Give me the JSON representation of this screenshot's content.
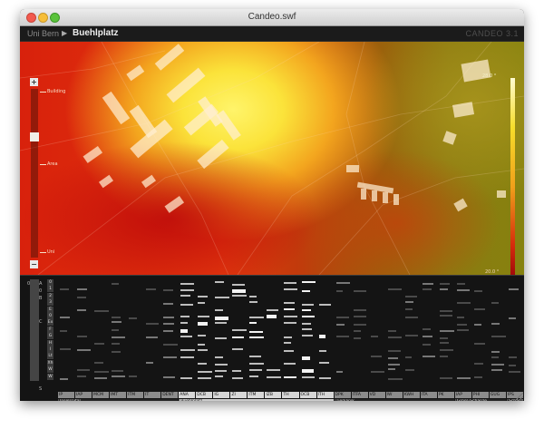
{
  "window": {
    "title": "Candeo.swf"
  },
  "header": {
    "breadcrumb_root": "Uni Bern",
    "breadcrumb_current": "Buehlplatz",
    "brand": "CANDEO 3.1"
  },
  "map": {
    "zoom_labels": [
      "Building",
      "Area",
      "Uni"
    ],
    "zoom_plus": "+",
    "zoom_minus": "−",
    "legend_max": "28.0 °",
    "legend_min": "20.0 °"
  },
  "panel": {
    "side_top_labels": [
      "0",
      "A",
      "0",
      "B",
      "C"
    ],
    "side_bottom_label": "S",
    "row_labels": [
      "0",
      "1",
      "2",
      "3",
      "E",
      "0",
      "Ex",
      "F",
      "G",
      "H",
      "I",
      "Lt",
      "Xh",
      "W",
      "W"
    ],
    "columns": [
      "IP",
      "IAP",
      "MCM",
      "IMT",
      "ITM",
      "IT",
      "DENT",
      "ANA",
      "DCB",
      "IG",
      "ZI",
      "ITM",
      "IZB",
      "TH",
      "OCB",
      "ITH",
      "DPK",
      "ITFA",
      "VD",
      "IW",
      "KWH",
      "ITA",
      "PK",
      "IAP",
      "PHI",
      "GUG",
      "IPS"
    ],
    "selected_columns": [
      7,
      8,
      9,
      10,
      11,
      12,
      13,
      14,
      15
    ],
    "groups": [
      "Inselspital",
      "Buehlplatz",
      "Tierklinik",
      "Gross-Schanze",
      "Schanzeneck"
    ],
    "selected_group": 1
  },
  "colors": {
    "heat_high": "#fff46a",
    "heat_mid": "#f3a51e",
    "heat_low": "#d11a0a",
    "panel_bg": "#141414"
  }
}
